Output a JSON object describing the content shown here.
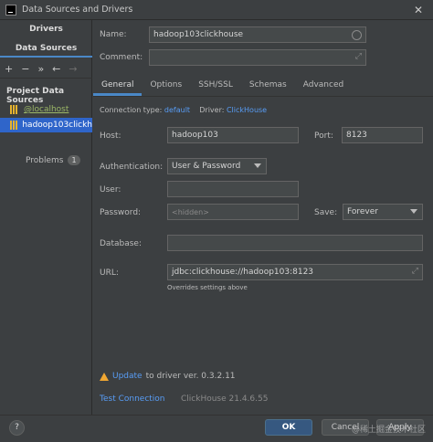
{
  "window": {
    "title": "Data Sources and Drivers"
  },
  "left": {
    "tabs": [
      "Drivers",
      "Data Sources"
    ],
    "toolbar": [
      "+",
      "−",
      "»",
      "←",
      "→"
    ],
    "section_header": "Project Data Sources",
    "items": [
      {
        "label": "@localhost"
      },
      {
        "label": "hadoop103clickh"
      }
    ],
    "problems_label": "Problems",
    "problems_count": "1"
  },
  "form": {
    "name_label": "Name:",
    "name_value": "hadoop103clickhouse",
    "comment_label": "Comment:",
    "comment_value": "",
    "tabs": [
      "General",
      "Options",
      "SSH/SSL",
      "Schemas",
      "Advanced"
    ],
    "active_tab": "General",
    "connection_type_label": "Connection type:",
    "connection_type_value": "default",
    "driver_label": "Driver:",
    "driver_value": "ClickHouse",
    "host_label": "Host:",
    "host_value": "hadoop103",
    "port_label": "Port:",
    "port_value": "8123",
    "auth_label": "Authentication:",
    "auth_value": "User & Password",
    "user_label": "User:",
    "user_value": "",
    "password_label": "Password:",
    "password_value": "<hidden>",
    "save_label": "Save:",
    "save_value": "Forever",
    "database_label": "Database:",
    "database_value": "",
    "url_label": "URL:",
    "url_value": "jdbc:clickhouse://hadoop103:8123",
    "url_hint": "Overrides settings above"
  },
  "footer": {
    "update_link": "Update",
    "update_text": "to driver ver. 0.3.2.11",
    "test_connection": "Test Connection",
    "clickhouse_version": "ClickHouse 21.4.6.55",
    "help": "?",
    "ok": "OK",
    "cancel": "Cancel",
    "apply": "Apply",
    "watermark": "@稀土掘金技术社区"
  },
  "colors": {
    "background": "#3c3f41",
    "accent": "#4a88c7",
    "link": "#589df6",
    "selection": "#2f65ca",
    "ok_button": "#365880",
    "warning": "#f0a732"
  }
}
